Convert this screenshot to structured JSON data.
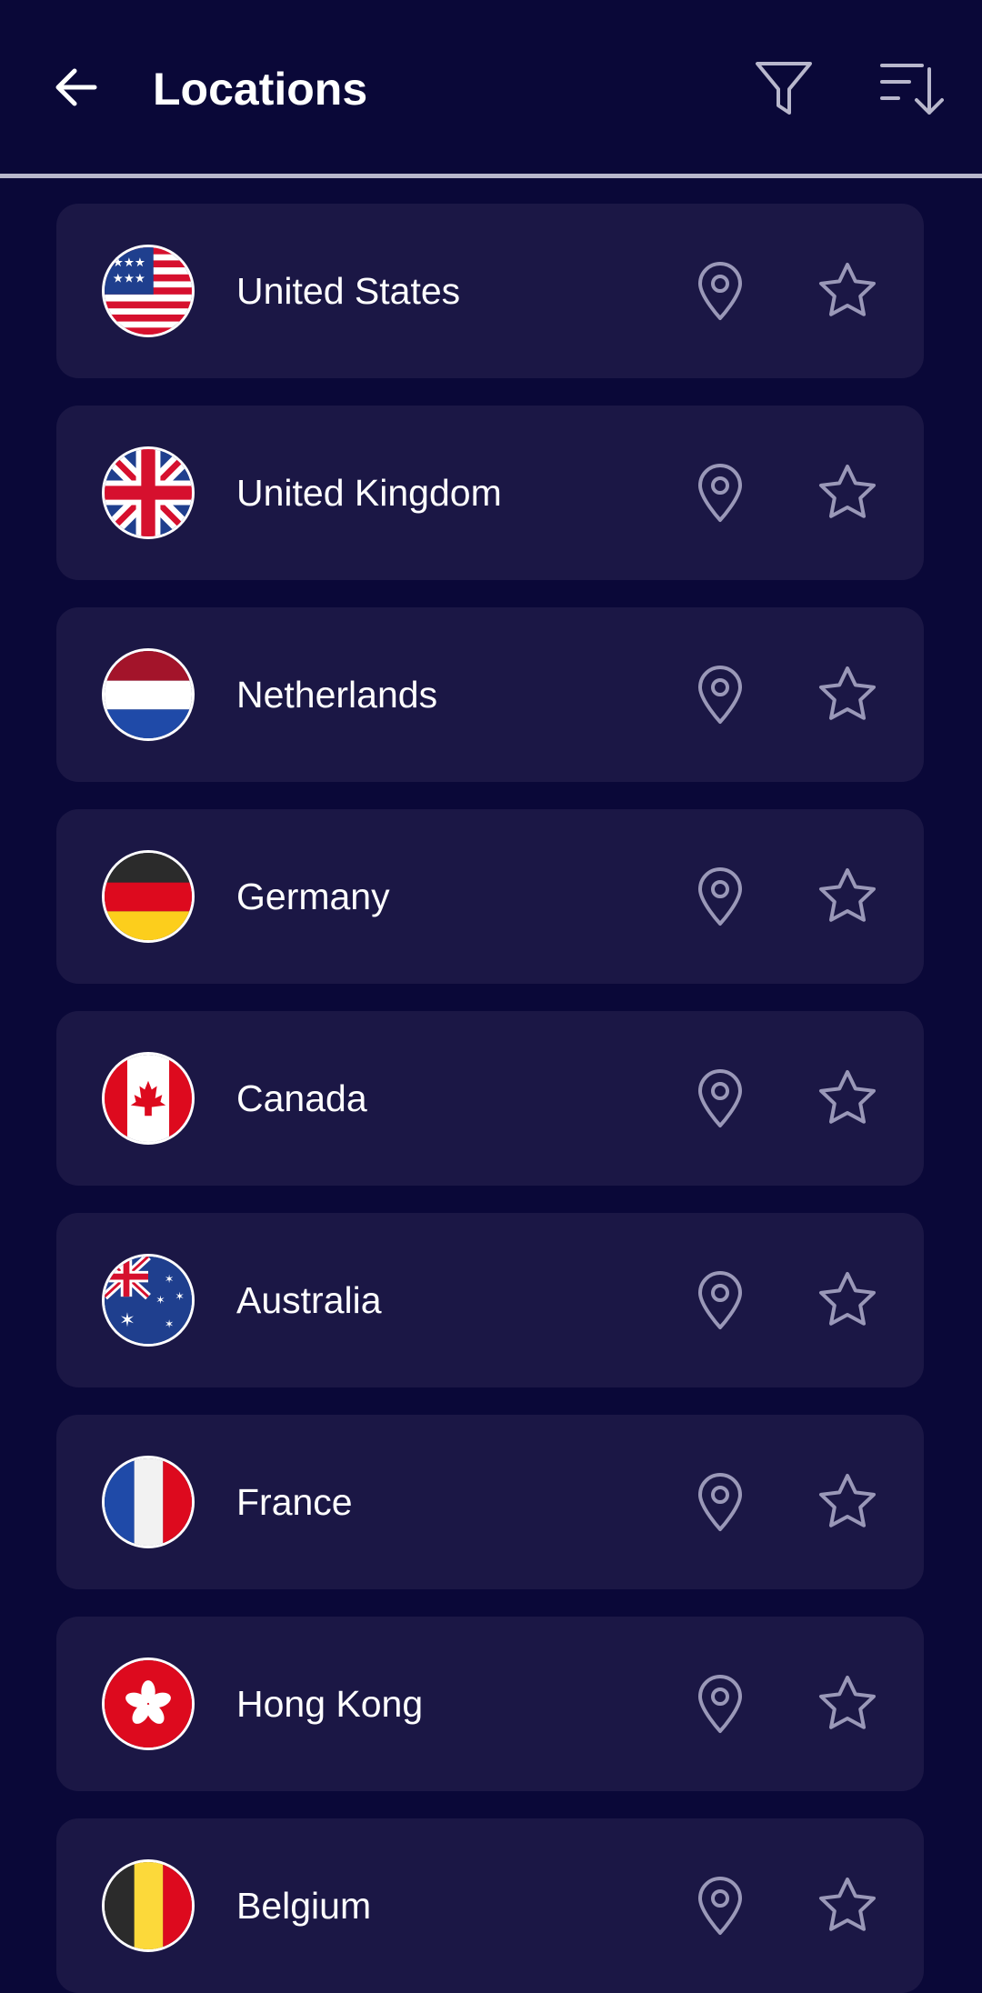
{
  "header": {
    "title": "Locations",
    "back_icon": "arrow-left-icon",
    "filter_icon": "filter-icon",
    "sort_icon": "sort-icon"
  },
  "colors": {
    "background": "#0a0838",
    "card": "#1b1745",
    "icon": "#9a98b8",
    "text": "#ffffff"
  },
  "locations": [
    {
      "name": "United States",
      "flag": "us-flag-icon"
    },
    {
      "name": "United Kingdom",
      "flag": "uk-flag-icon"
    },
    {
      "name": "Netherlands",
      "flag": "nl-flag-icon"
    },
    {
      "name": "Germany",
      "flag": "de-flag-icon"
    },
    {
      "name": "Canada",
      "flag": "ca-flag-icon"
    },
    {
      "name": "Australia",
      "flag": "au-flag-icon"
    },
    {
      "name": "France",
      "flag": "fr-flag-icon"
    },
    {
      "name": "Hong Kong",
      "flag": "hk-flag-icon"
    },
    {
      "name": "Belgium",
      "flag": "be-flag-icon"
    }
  ]
}
